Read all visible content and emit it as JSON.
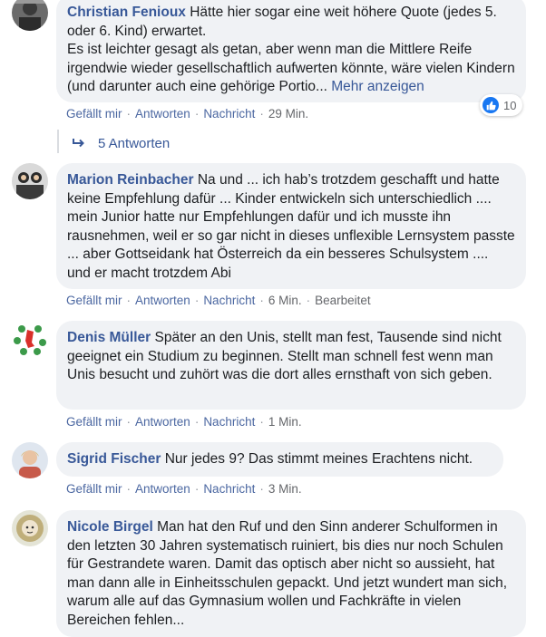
{
  "comments": [
    {
      "author": "Christian Fenioux",
      "text": "Hätte hier sogar eine weit höhere Quote (jedes 5. oder 6. Kind) erwartet.",
      "text2": "Es ist leichter gesagt als getan, aber wenn man die Mittlere Reife irgendwie wieder gesellschaftlich aufwerten könnte, wäre vielen Kindern (und darunter auch eine gehörige Portio...",
      "more": "Mehr anzeigen",
      "reaction_count": "10",
      "actions": {
        "like": "Gefällt mir",
        "reply": "Antworten",
        "message": "Nachricht",
        "time": "29 Min."
      },
      "replies_label": "5 Antworten"
    },
    {
      "author": "Marion Reinbacher",
      "text": "Na und ... ich hab’s trotzdem geschafft und hatte keine Empfehlung dafür ... Kinder entwickeln sich unterschiedlich .... mein Junior hatte nur Empfehlungen dafür und ich musste ihn rausnehmen, weil er so gar nicht in dieses unflexible Lernsystem passte ... aber Gottseidank hat Österreich da ein besseres Schulsystem .... und er macht trotzdem Abi",
      "actions": {
        "like": "Gefällt mir",
        "reply": "Antworten",
        "message": "Nachricht",
        "time": "6 Min.",
        "edited": "Bearbeitet"
      }
    },
    {
      "author": "Denis Müller",
      "text": "Später an den Unis, stellt man fest, Tausende sind nicht geeignet ein Studium zu beginnen. Stellt man schnell fest wenn man Unis besucht und zuhört was die dort alles ernsthaft von sich geben.",
      "actions": {
        "like": "Gefällt mir",
        "reply": "Antworten",
        "message": "Nachricht",
        "time": "1 Min."
      }
    },
    {
      "author": "Sigrid Fischer",
      "text": "Nur jedes 9? Das stimmt meines Erachtens nicht.",
      "actions": {
        "like": "Gefällt mir",
        "reply": "Antworten",
        "message": "Nachricht",
        "time": "3 Min."
      }
    },
    {
      "author": "Nicole Birgel",
      "text": "Man hat den Ruf und den Sinn anderer Schulformen in den letzten 30 Jahren systematisch ruiniert, bis dies nur noch Schulen für Gestrandete waren. Damit das optisch aber nicht so aussieht, hat man dann alle in Einheitsschulen gepackt. Und jetzt wundert man sich, warum alle auf das Gymnasium wollen und Fachkräfte in vielen Bereichen fehlen..."
    }
  ],
  "icons": {
    "like": "thumbs-up-icon",
    "reply_arrow": "reply-arrow-icon"
  },
  "colors": {
    "author": "#385898",
    "bubble": "#f0f2f5",
    "like": "#1877f2"
  }
}
